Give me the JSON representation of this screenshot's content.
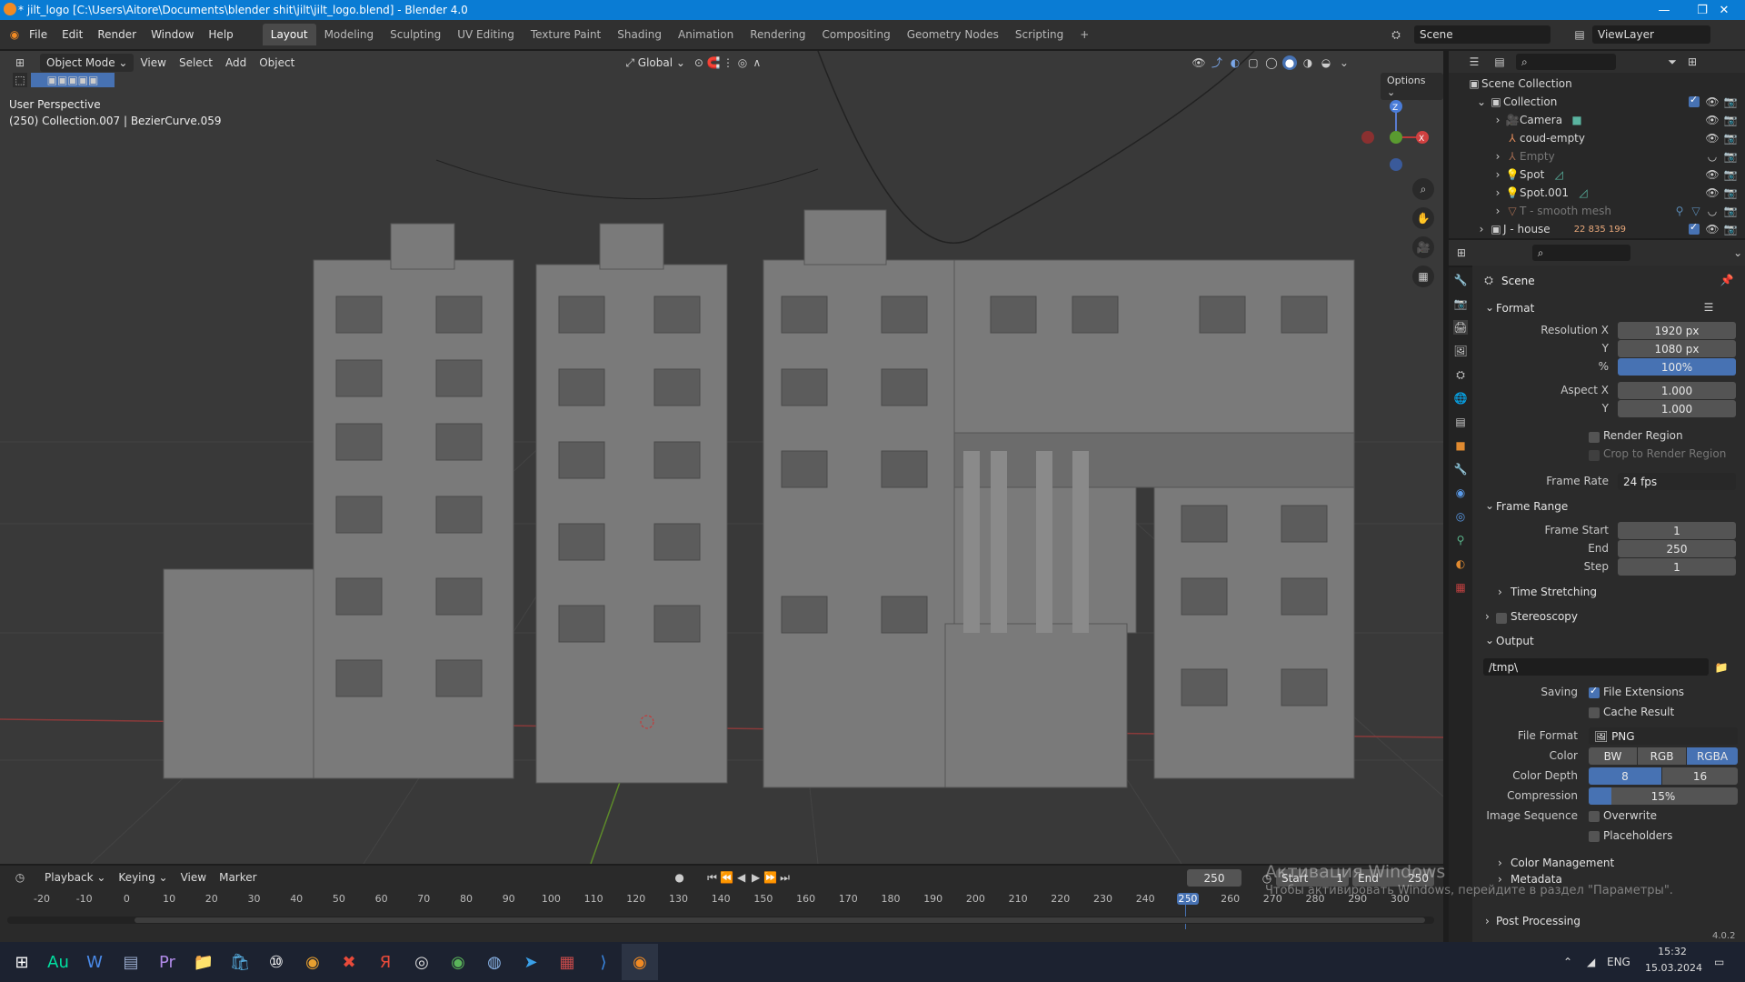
{
  "window": {
    "title": "* jilt_logo [C:\\Users\\Aitore\\Documents\\blender shit\\jilt\\jilt_logo.blend] - Blender 4.0",
    "min": "—",
    "max": "❐",
    "close": "✕"
  },
  "menu": [
    "File",
    "Edit",
    "Render",
    "Window",
    "Help"
  ],
  "workspaces": [
    "Layout",
    "Modeling",
    "Sculpting",
    "UV Editing",
    "Texture Paint",
    "Shading",
    "Animation",
    "Rendering",
    "Compositing",
    "Geometry Nodes",
    "Scripting"
  ],
  "workspace_add": "+",
  "scene_field": "Scene",
  "viewlayer_field": "ViewLayer",
  "viewport": {
    "mode": "Object Mode",
    "menus": [
      "View",
      "Select",
      "Add",
      "Object"
    ],
    "transform": "Global",
    "options": "Options",
    "info_line1": "User Perspective",
    "info_line2": "(250) Collection.007 | BezierCurve.059",
    "gizmo": {
      "z": "Z",
      "x": "X"
    }
  },
  "outliner": {
    "root": "Scene Collection",
    "items": [
      {
        "label": "Collection",
        "indent": 0
      },
      {
        "label": "Camera",
        "indent": 1
      },
      {
        "label": "coud-empty",
        "indent": 1
      },
      {
        "label": "Empty",
        "indent": 1,
        "dim": true
      },
      {
        "label": "Spot",
        "indent": 1
      },
      {
        "label": "Spot.001",
        "indent": 1
      },
      {
        "label": "T - smooth mesh",
        "indent": 1,
        "dim": true
      },
      {
        "label": "J - house",
        "indent": 0
      }
    ],
    "jhouse_count": "22 835 199"
  },
  "properties": {
    "context": "Scene",
    "format_label": "Format",
    "res_x_label": "Resolution X",
    "res_x": "1920 px",
    "res_y_label": "Y",
    "res_y": "1080 px",
    "pct_label": "%",
    "pct": "100%",
    "aspect_x_label": "Aspect X",
    "aspect_x": "1.000",
    "aspect_y_label": "Y",
    "aspect_y": "1.000",
    "render_region": "Render Region",
    "crop": "Crop to Render Region",
    "frame_rate_label": "Frame Rate",
    "frame_rate": "24 fps",
    "frame_range": "Frame Range",
    "frame_start_label": "Frame Start",
    "frame_start": "1",
    "end_label": "End",
    "end": "250",
    "step_label": "Step",
    "step": "1",
    "time_stretching": "Time Stretching",
    "stereoscopy": "Stereoscopy",
    "output": "Output",
    "output_path": "/tmp\\",
    "saving_label": "Saving",
    "file_ext": "File Extensions",
    "cache": "Cache Result",
    "file_format_label": "File Format",
    "file_format": "PNG",
    "color_label": "Color",
    "color_opts": [
      "BW",
      "RGB",
      "RGBA"
    ],
    "depth_label": "Color Depth",
    "depth_opts": [
      "8",
      "16"
    ],
    "compression_label": "Compression",
    "compression": "15%",
    "compression_value": 0.15,
    "img_seq_label": "Image Sequence",
    "overwrite": "Overwrite",
    "placeholders": "Placeholders",
    "color_mgmt": "Color Management",
    "metadata": "Metadata",
    "post_processing": "Post Processing"
  },
  "timeline": {
    "menus": [
      "Playback",
      "Keying",
      "View",
      "Marker"
    ],
    "current_frame": "250",
    "start_label": "Start",
    "start": "1",
    "end_label": "End",
    "end": "250",
    "ticks": [
      "-20",
      "-10",
      "0",
      "10",
      "20",
      "30",
      "40",
      "50",
      "60",
      "70",
      "80",
      "90",
      "100",
      "110",
      "120",
      "130",
      "140",
      "150",
      "160",
      "170",
      "180",
      "190",
      "200",
      "210",
      "220",
      "230",
      "240",
      "250",
      "260",
      "270",
      "280",
      "290",
      "300"
    ]
  },
  "watermark": {
    "line1": "Активация Windows",
    "line2": "Чтобы активировать Windows, перейдите в раздел \"Параметры\"."
  },
  "version": "4.0.2",
  "taskbar": {
    "lang": "ENG",
    "time": "15:32",
    "date": "15.03.2024",
    "icons": [
      "windows-start",
      "audition",
      "word",
      "notepad",
      "premiere",
      "explorer",
      "store",
      "app-10",
      "chrome",
      "xmind",
      "yandex-browser",
      "obs",
      "chrome-2",
      "app-steam",
      "telegram",
      "winrar",
      "vscode",
      "blender"
    ]
  }
}
